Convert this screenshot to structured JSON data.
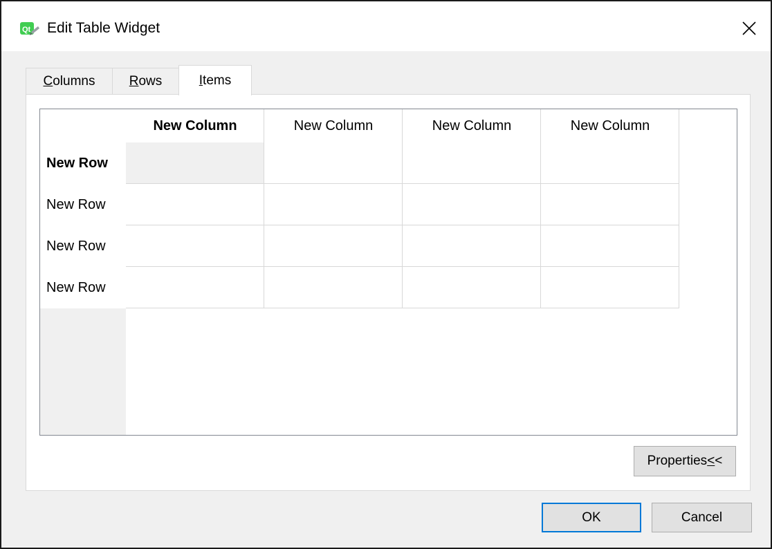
{
  "window": {
    "title": "Edit Table Widget",
    "app_icon": "qt-designer-icon",
    "close_icon": "close-icon"
  },
  "tabs": [
    {
      "label": "Columns",
      "mnemonic": "C",
      "rest": "olumns",
      "active": false
    },
    {
      "label": "Rows",
      "mnemonic": "R",
      "rest": "ows",
      "active": false
    },
    {
      "label": "Items",
      "mnemonic": "I",
      "rest": "tems",
      "active": true
    }
  ],
  "table": {
    "columns": [
      "New Column",
      "New Column",
      "New Column",
      "New Column"
    ],
    "rows": [
      "New Row",
      "New Row",
      "New Row",
      "New Row"
    ],
    "current_row": 0,
    "current_column": 0
  },
  "properties_button": {
    "label": "Properties <<",
    "text": "Properties ",
    "mnemonic": "<",
    "rest": "<"
  },
  "footer": {
    "ok_label": "OK",
    "cancel_label": "Cancel"
  },
  "colors": {
    "window_bg": "#f0f0f0",
    "default_button_border": "#0078d7",
    "current_cell_bg": "#f0f0f0"
  }
}
